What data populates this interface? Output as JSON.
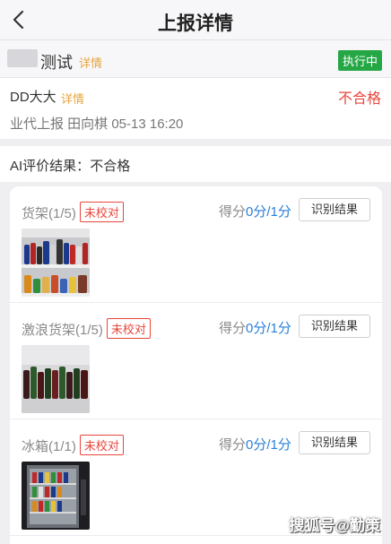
{
  "header": {
    "title": "上报详情",
    "back_icon": "chevron-left-icon"
  },
  "task": {
    "name": "测试",
    "detail_link": "详情",
    "status": "执行中",
    "status_color": "#26a746"
  },
  "report": {
    "reporter": "DD大大",
    "detail_link": "详情",
    "verdict": "不合格",
    "verdict_color": "#e8453c",
    "meta": "业代上报 田向棋 05-13 16:20"
  },
  "ai_result": {
    "label": "AI评价结果：",
    "value": "不合格"
  },
  "items": [
    {
      "name": "货架",
      "count": "(1/5)",
      "tag": "未校对",
      "score_label": "得分",
      "score_value": "0分/1分",
      "button": "识别结果"
    },
    {
      "name": "激浪货架",
      "count": "(1/5)",
      "tag": "未校对",
      "score_label": "得分",
      "score_value": "0分/1分",
      "button": "识别结果"
    },
    {
      "name": "冰箱",
      "count": "(1/1)",
      "tag": "未校对",
      "score_label": "得分",
      "score_value": "0分/1分",
      "button": "识别结果"
    }
  ],
  "accent_colors": {
    "link": "#e7a43f",
    "score": "#2a7fd8",
    "tag": "#e8453c"
  },
  "watermark": "搜狐号@勤策"
}
